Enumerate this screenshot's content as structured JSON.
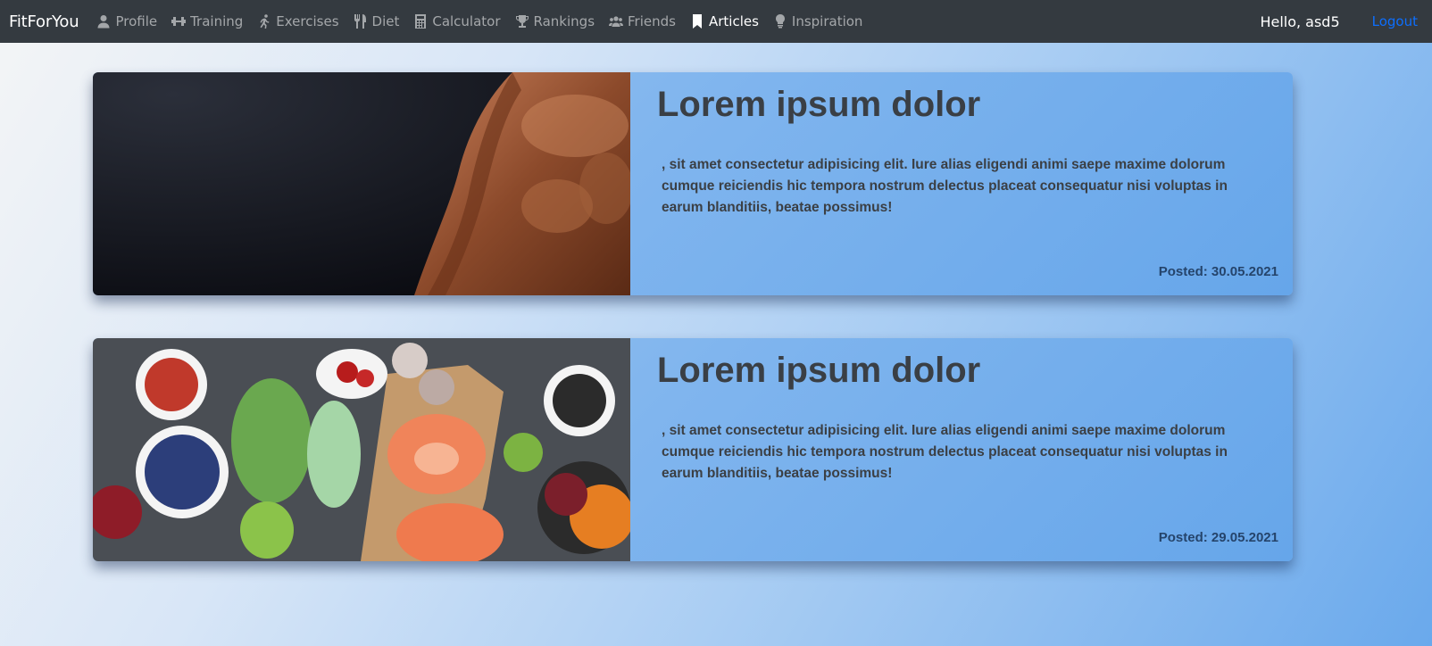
{
  "navbar": {
    "brand": "FitForYou",
    "items": [
      {
        "label": "Profile",
        "icon": "user-icon"
      },
      {
        "label": "Training",
        "icon": "dumbbell-icon"
      },
      {
        "label": "Exercises",
        "icon": "running-icon"
      },
      {
        "label": "Diet",
        "icon": "utensils-icon"
      },
      {
        "label": "Calculator",
        "icon": "calculator-icon"
      },
      {
        "label": "Rankings",
        "icon": "trophy-icon"
      },
      {
        "label": "Friends",
        "icon": "users-icon"
      },
      {
        "label": "Articles",
        "icon": "bookmark-icon",
        "active": true
      },
      {
        "label": "Inspiration",
        "icon": "lightbulb-icon"
      }
    ],
    "greeting": "Hello, asd5",
    "logout_label": "Logout"
  },
  "articles": [
    {
      "title": "Lorem ipsum dolor",
      "text": ", sit amet consectetur adipisicing elit. Iure alias eligendi animi saepe maxime dolorum cumque reiciendis hic tempora nostrum delectus placeat consequatur nisi voluptas in earum blanditiis, beatae possimus!",
      "date": "Posted: 30.05.2021",
      "image": "fitness-man-photo"
    },
    {
      "title": "Lorem ipsum dolor",
      "text": ", sit amet consectetur adipisicing elit. Iure alias eligendi animi saepe maxime dolorum cumque reiciendis hic tempora nostrum delectus placeat consequatur nisi voluptas in earum blanditiis, beatae possimus!",
      "date": "Posted: 29.05.2021",
      "image": "healthy-food-photo"
    }
  ],
  "colors": {
    "navbar_bg": "#343a40",
    "logout": "#0d6efd",
    "date_text": "#25446b"
  }
}
